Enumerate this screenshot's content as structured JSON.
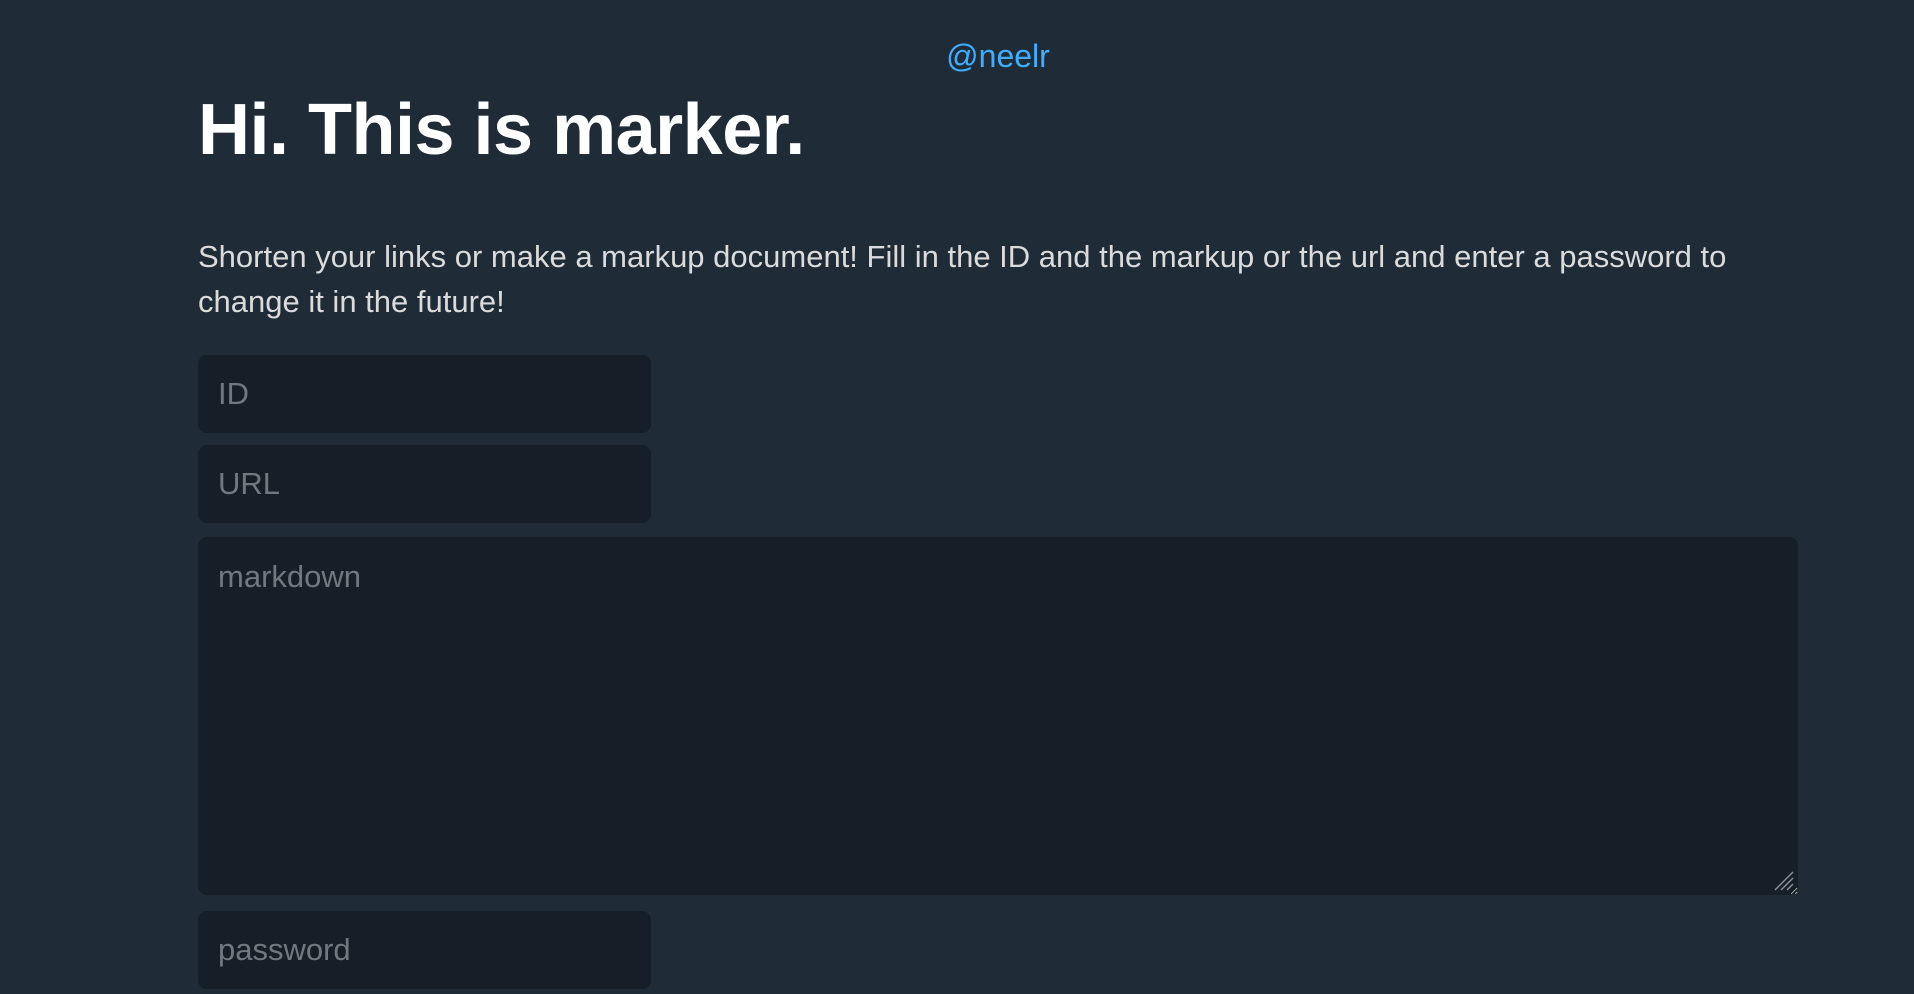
{
  "header": {
    "user_link": "@neelr"
  },
  "main": {
    "title": "Hi. This is marker.",
    "intro": "Shorten your links or make a markup document! Fill in the ID and the markup or the url and enter a password to change it in the future!"
  },
  "form": {
    "id_placeholder": "ID",
    "url_placeholder": "URL",
    "markdown_placeholder": "markdown",
    "password_placeholder": "password"
  },
  "colors": {
    "background": "#202b38",
    "input_background": "#161f27",
    "link": "#41adff",
    "text": "#dbdbdb",
    "placeholder": "#717880"
  }
}
